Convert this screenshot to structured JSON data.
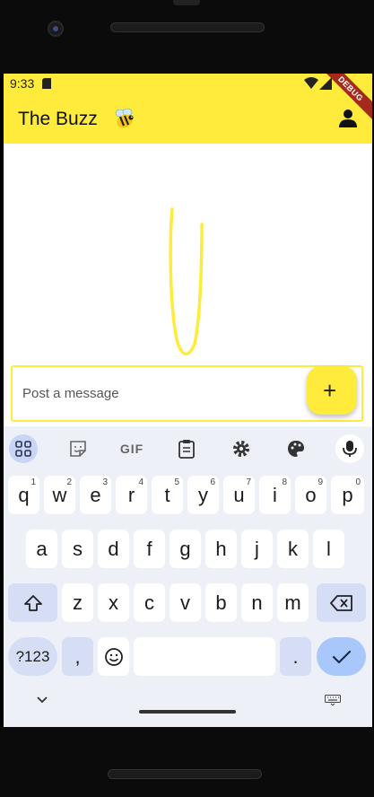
{
  "status_bar": {
    "time": "9:33"
  },
  "debug_banner": "DEBUG",
  "app_bar": {
    "title": "The Buzz"
  },
  "composer": {
    "placeholder": "Post a message",
    "add_label": "+"
  },
  "keyboard": {
    "row1": [
      {
        "key": "q",
        "hint": "1"
      },
      {
        "key": "w",
        "hint": "2"
      },
      {
        "key": "e",
        "hint": "3"
      },
      {
        "key": "r",
        "hint": "4"
      },
      {
        "key": "t",
        "hint": "5"
      },
      {
        "key": "y",
        "hint": "6"
      },
      {
        "key": "u",
        "hint": "7"
      },
      {
        "key": "i",
        "hint": "8"
      },
      {
        "key": "o",
        "hint": "9"
      },
      {
        "key": "p",
        "hint": "0"
      }
    ],
    "row2": [
      "a",
      "s",
      "d",
      "f",
      "g",
      "h",
      "j",
      "k",
      "l"
    ],
    "row3": [
      "z",
      "x",
      "c",
      "v",
      "b",
      "n",
      "m"
    ],
    "symbols_label": "?123",
    "comma": ",",
    "period": ".",
    "toolbar_gif": "GIF"
  },
  "colors": {
    "accent": "#ffeb3b",
    "keyboard_bg": "#eef0f8",
    "key_alt": "#d6def5"
  }
}
